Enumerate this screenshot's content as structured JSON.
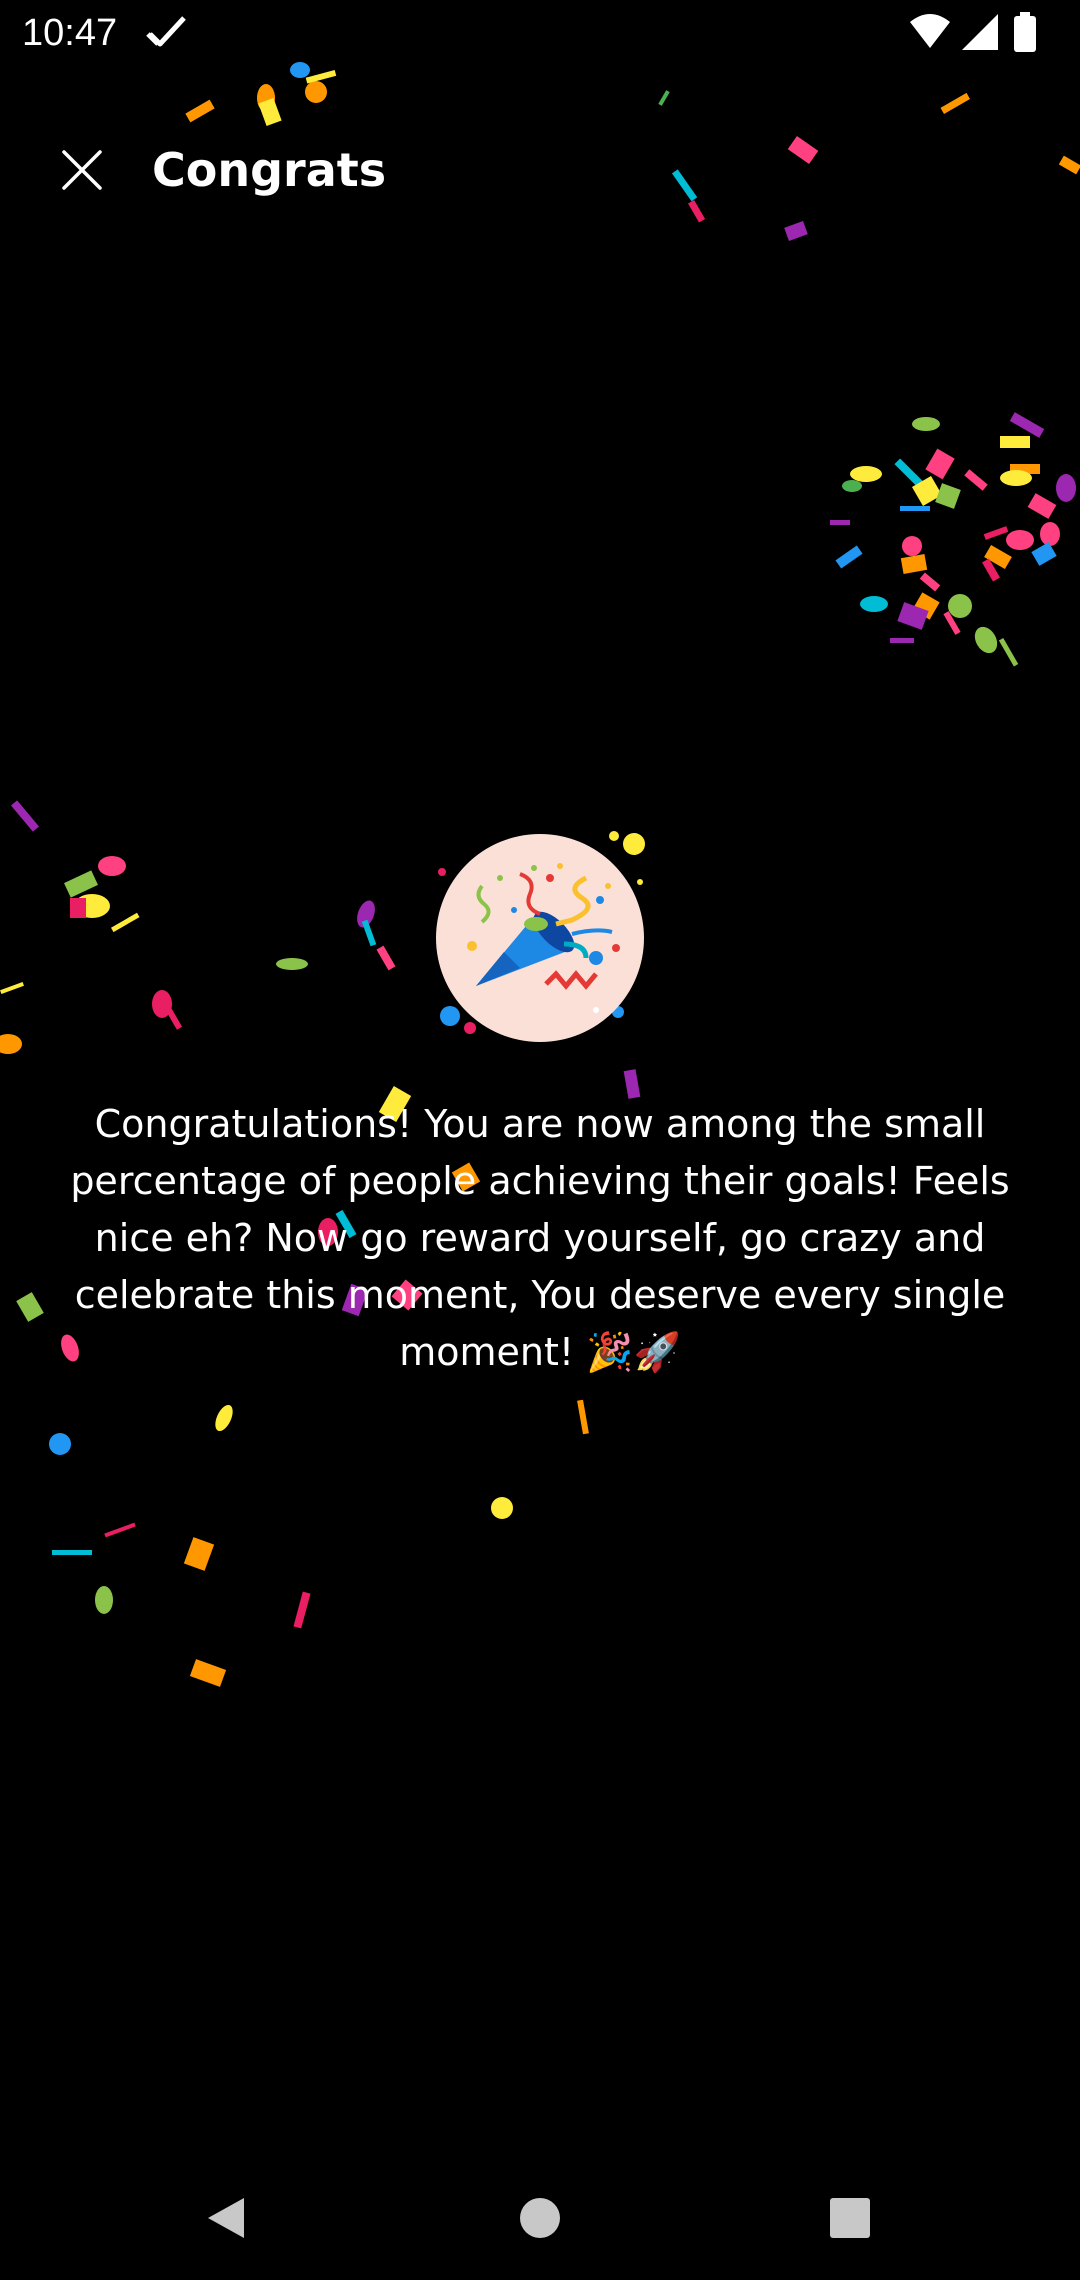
{
  "status_bar": {
    "time": "10:47",
    "icons": [
      "check-icon",
      "wifi-icon",
      "cell-signal-icon",
      "battery-icon"
    ]
  },
  "header": {
    "title": "Congrats",
    "close_icon": "close-icon"
  },
  "main": {
    "badge_icon": "party-popper-icon",
    "message": "Congratulations! You are now among the small percentage of people achieving their goals! Feels nice eh? Now go reward yourself, go crazy and celebrate this moment, You deserve every single moment! 🎉🚀"
  },
  "nav_bar": {
    "icons": [
      "back-icon",
      "home-icon",
      "recents-icon"
    ]
  },
  "colors": {
    "background": "#000000",
    "text": "#ffffff",
    "badge_background": "#fae0d6",
    "popper_blue": "#1e88e5",
    "confetti": [
      "#ff9800",
      "#ffeb3b",
      "#e91e63",
      "#9c27b0",
      "#2196f3",
      "#4caf50",
      "#00bcd4",
      "#8bc34a",
      "#ff4081"
    ]
  }
}
